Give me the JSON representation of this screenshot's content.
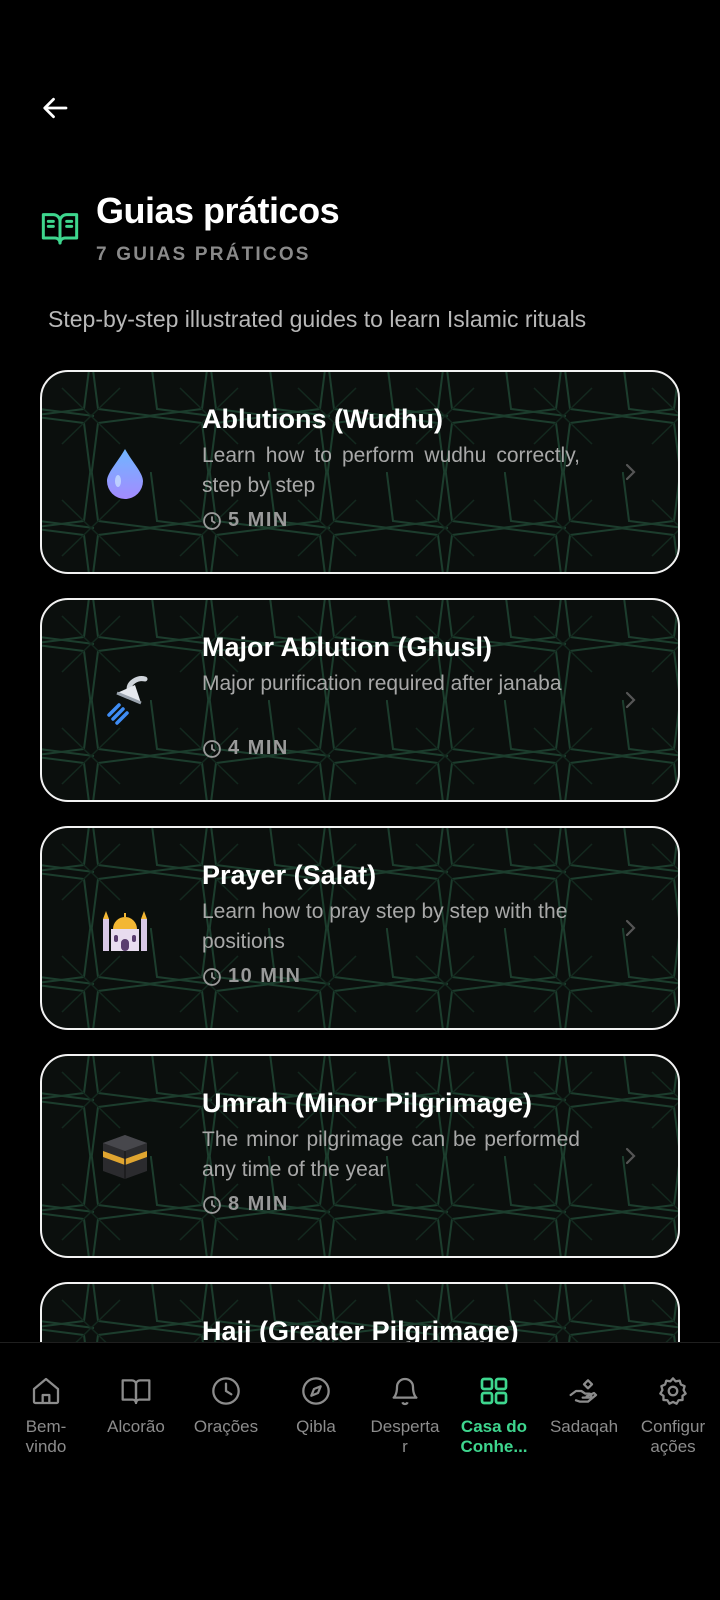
{
  "header": {
    "title": "Guias práticos",
    "subtitle": "7 GUIAS PRÁTICOS",
    "intro": "Step-by-step illustrated guides to learn Islamic rituals"
  },
  "colors": {
    "accent": "#3ed68e",
    "background": "#000000",
    "card_border": "#f2f2f2"
  },
  "guides": [
    {
      "title": "Ablutions (Wudhu)",
      "description": "Learn how to perform wudhu correctly, step by step",
      "duration": "5 MIN",
      "icon": "water-drop-icon"
    },
    {
      "title": "Major Ablution (Ghusl)",
      "description": "Major purification required after janaba",
      "duration": "4 MIN",
      "icon": "shower-icon"
    },
    {
      "title": "Prayer (Salat)",
      "description": "Learn how to pray step by step with the positions",
      "duration": "10 MIN",
      "icon": "mosque-icon"
    },
    {
      "title": "Umrah (Minor Pilgrimage)",
      "description": "The minor pilgrimage can be performed any time of the year",
      "duration": "8 MIN",
      "icon": "kaaba-icon"
    },
    {
      "title": "Hajj (Greater Pilgrimage)"
    }
  ],
  "nav": [
    {
      "label": "Bem-\nvindo",
      "icon": "home-icon"
    },
    {
      "label": "Alcorão",
      "icon": "book-icon"
    },
    {
      "label": "Orações",
      "icon": "clock-icon"
    },
    {
      "label": "Qibla",
      "icon": "compass-icon"
    },
    {
      "label": "Desperta\nr",
      "icon": "bell-icon"
    },
    {
      "label": "Casa do\nConhe...",
      "icon": "grid-icon",
      "active": true
    },
    {
      "label": "Sadaqah",
      "icon": "giving-hand-icon"
    },
    {
      "label": "Configur\nações",
      "icon": "gear-icon"
    }
  ]
}
